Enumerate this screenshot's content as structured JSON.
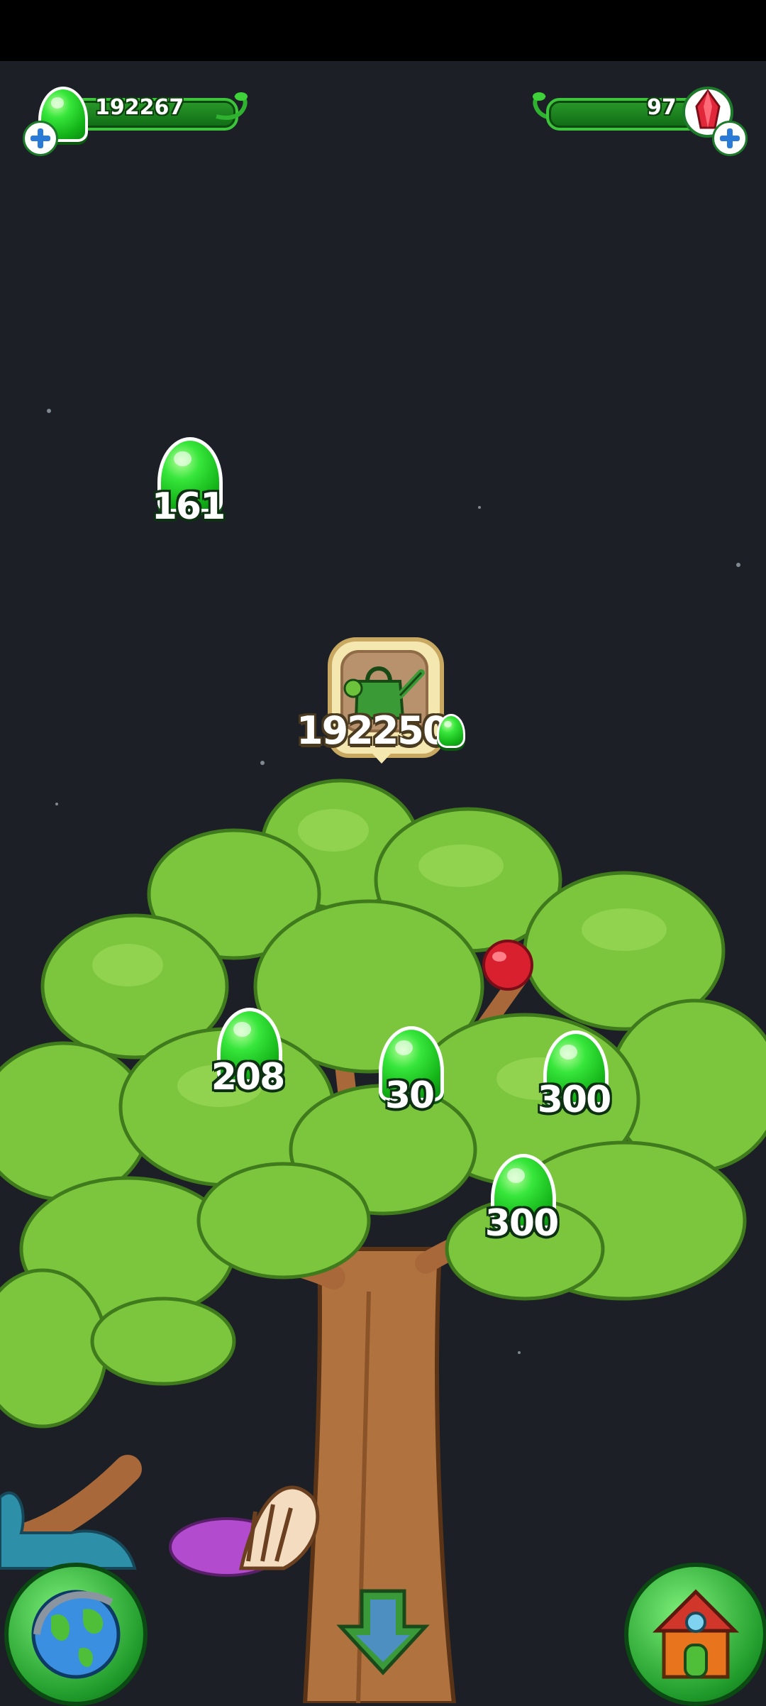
{
  "hud": {
    "jelly_count": "192267",
    "gem_count": "97"
  },
  "tree": {
    "upgrade_cost": "192250",
    "jelly_rewards": [
      "161",
      "208",
      "30",
      "300",
      "300"
    ]
  },
  "icons": {
    "jelly": "green-jelly-icon",
    "gem": "red-crystal-icon",
    "add": "plus-icon",
    "upgrade": "watering-can-icon",
    "world": "globe-icon",
    "home": "house-icon",
    "scroll": "down-arrow-icon"
  },
  "colors": {
    "background": "#1c2026",
    "jelly_green": "#22c81f",
    "leaf_green": "#7cc63e",
    "trunk_brown": "#b0723e"
  }
}
